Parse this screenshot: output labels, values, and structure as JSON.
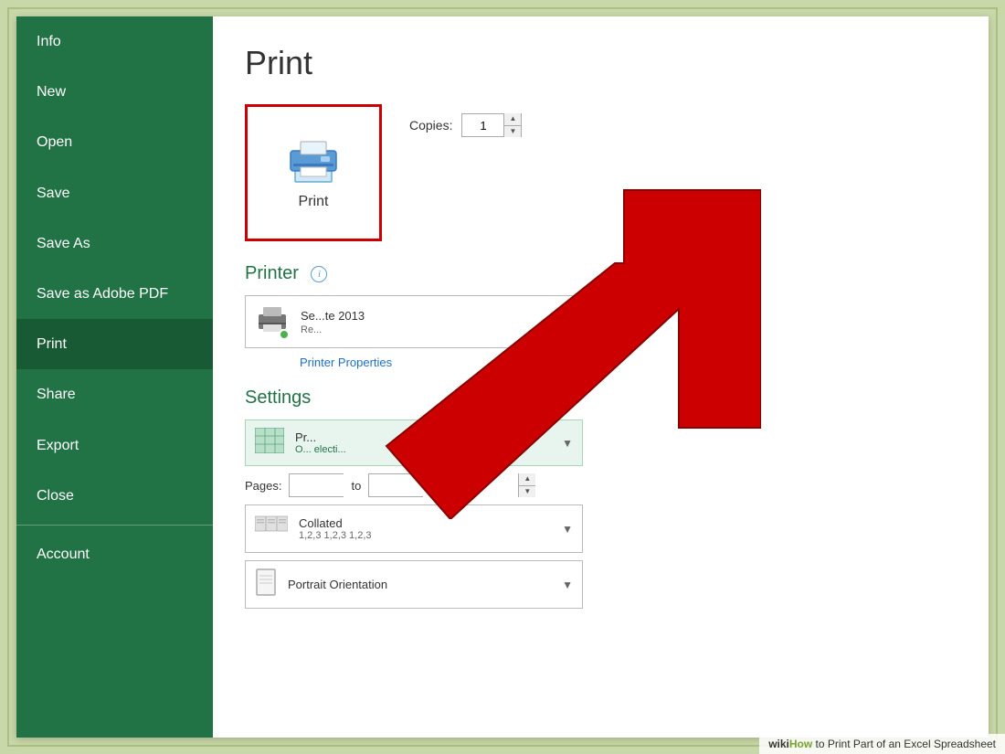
{
  "sidebar": {
    "items": [
      {
        "id": "info",
        "label": "Info"
      },
      {
        "id": "new",
        "label": "New"
      },
      {
        "id": "open",
        "label": "Open"
      },
      {
        "id": "save",
        "label": "Save"
      },
      {
        "id": "save-as",
        "label": "Save As"
      },
      {
        "id": "save-adobe",
        "label": "Save as Adobe PDF"
      },
      {
        "id": "print",
        "label": "Print",
        "active": true
      },
      {
        "id": "share",
        "label": "Share"
      },
      {
        "id": "export",
        "label": "Export"
      },
      {
        "id": "close",
        "label": "Close"
      },
      {
        "id": "account",
        "label": "Account"
      }
    ]
  },
  "main": {
    "title": "Print",
    "print_button_label": "Print",
    "copies_label": "Copies:",
    "copies_value": "1",
    "printer_section_header": "Printer",
    "printer_name": "Se...te 2013",
    "printer_status": "Re...",
    "printer_properties_link": "Printer Properties",
    "settings_section_header": "Settings",
    "settings_main": "Pr...",
    "settings_sub": "O... electi...",
    "pages_label": "Pages:",
    "pages_to": "to",
    "collated_main": "Collated",
    "collated_sub": "1,2,3   1,2,3   1,2,3",
    "portrait_label": "Portrait Orientation"
  },
  "wikihow": {
    "wiki": "wiki",
    "how": "How",
    "text": " to Print Part of an Excel Spreadsheet"
  }
}
